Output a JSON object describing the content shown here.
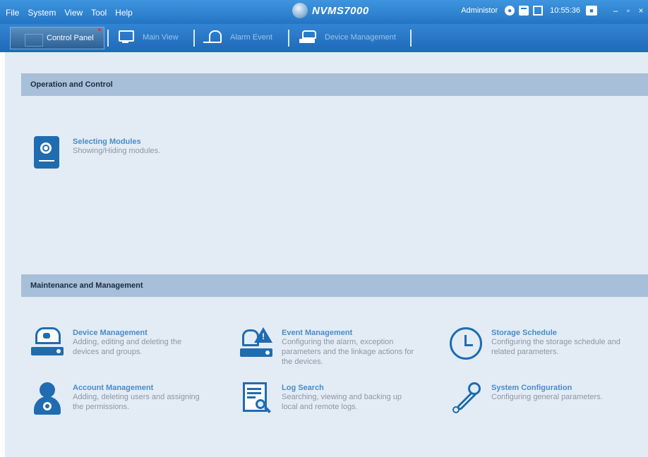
{
  "menu": [
    "File",
    "System",
    "View",
    "Tool",
    "Help"
  ],
  "app": {
    "name": "NVMS7000",
    "logo_icon": "globe-logo-icon"
  },
  "status": {
    "user": "Administor",
    "time": "10:55:36"
  },
  "window_controls": {
    "minimize": "–",
    "maximize": "▫",
    "close": "×"
  },
  "tabs": [
    {
      "label": "Control Panel",
      "icon": "control-panel-icon",
      "active": true
    },
    {
      "label": "Main View",
      "icon": "monitor-icon",
      "active": false
    },
    {
      "label": "Alarm Event",
      "icon": "bell-icon",
      "active": false
    },
    {
      "label": "Device Management",
      "icon": "device-icon",
      "active": false
    }
  ],
  "sections": {
    "operation": {
      "title": "Operation and Control",
      "items": [
        {
          "title": "Selecting Modules",
          "desc": "Showing/Hiding modules.",
          "icon": "module-icon"
        }
      ]
    },
    "maintenance": {
      "title": "Maintenance and Management",
      "items": [
        {
          "title": "Device Management",
          "desc_lines": [
            "Adding, editing and deleting the",
            "devices and groups."
          ],
          "icon": "device-management-icon"
        },
        {
          "title": "Event Management",
          "desc_lines": [
            "Configuring the alarm, exception",
            "parameters and the linkage actions for",
            "the devices."
          ],
          "icon": "event-management-icon"
        },
        {
          "title": "Storage Schedule",
          "desc_lines": [
            "Configuring the storage schedule and",
            "related parameters."
          ],
          "icon": "clock-icon"
        },
        {
          "title": "Account Management",
          "desc_lines": [
            "Adding, deleting users and assigning",
            "the permissions."
          ],
          "icon": "account-icon"
        },
        {
          "title": "Log Search",
          "desc_lines": [
            "Searching, viewing and backing up",
            "local and remote logs."
          ],
          "icon": "log-search-icon"
        },
        {
          "title": "System Configuration",
          "desc_lines": [
            "Configuring general parameters."
          ],
          "icon": "wrench-icon"
        }
      ]
    }
  },
  "colors": {
    "accent": "#1f6cb1",
    "title_blue": "#4a8cc7",
    "header_bg": "#a7bfd9",
    "panel_bg": "#e3ecf5",
    "bar_blue": "#2a7cc8"
  }
}
